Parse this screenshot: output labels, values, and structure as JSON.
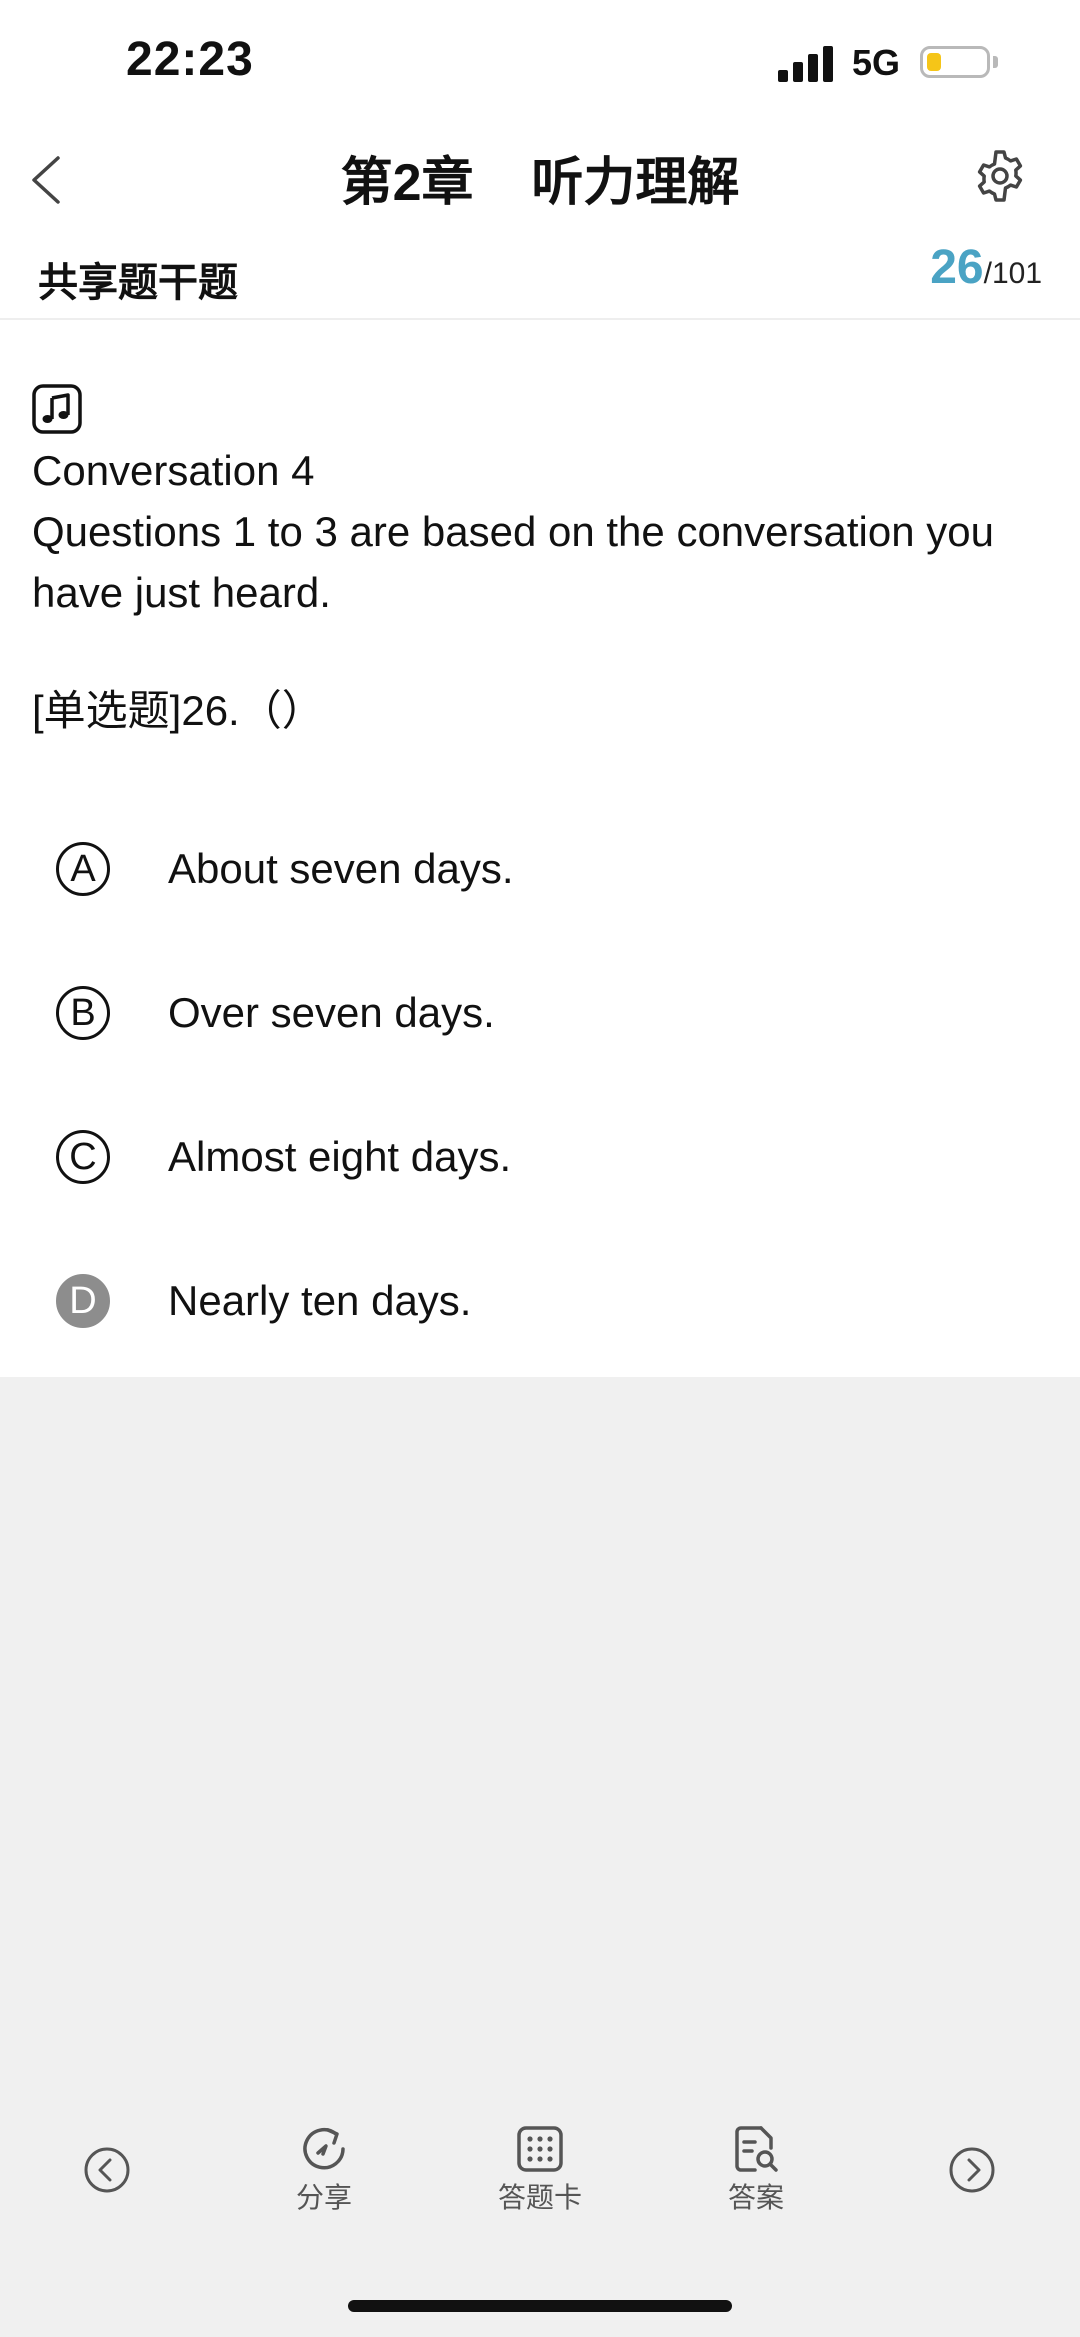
{
  "status_bar": {
    "time": "22:23",
    "network": "5G",
    "battery_level": 0.25,
    "battery_color": "#f5c518"
  },
  "nav": {
    "title": "第2章    听力理解",
    "back_icon": "chevron-left-icon",
    "settings_icon": "gear-icon"
  },
  "sub_header": {
    "title": "共享题干题",
    "current": "26",
    "total": "/101",
    "accent_color": "#4aa3c4"
  },
  "content": {
    "audio_icon": "music-note-icon",
    "passage_title": "Conversation 4",
    "passage_text": "Questions 1 to 3 are based on the conversation you have just heard.",
    "question_stem": "[单选题]26.（）",
    "options": [
      {
        "letter": "A",
        "text": "About seven days.",
        "selected": false
      },
      {
        "letter": "B",
        "text": "Over seven days.",
        "selected": false
      },
      {
        "letter": "C",
        "text": "Almost eight days.",
        "selected": false
      },
      {
        "letter": "D",
        "text": "Nearly ten days.",
        "selected": true
      }
    ]
  },
  "toolbar": {
    "prev_icon": "circle-chevron-left-icon",
    "share_label": "分享",
    "answer_card_label": "答题卡",
    "answer_label": "答案",
    "next_icon": "circle-chevron-right-icon"
  }
}
